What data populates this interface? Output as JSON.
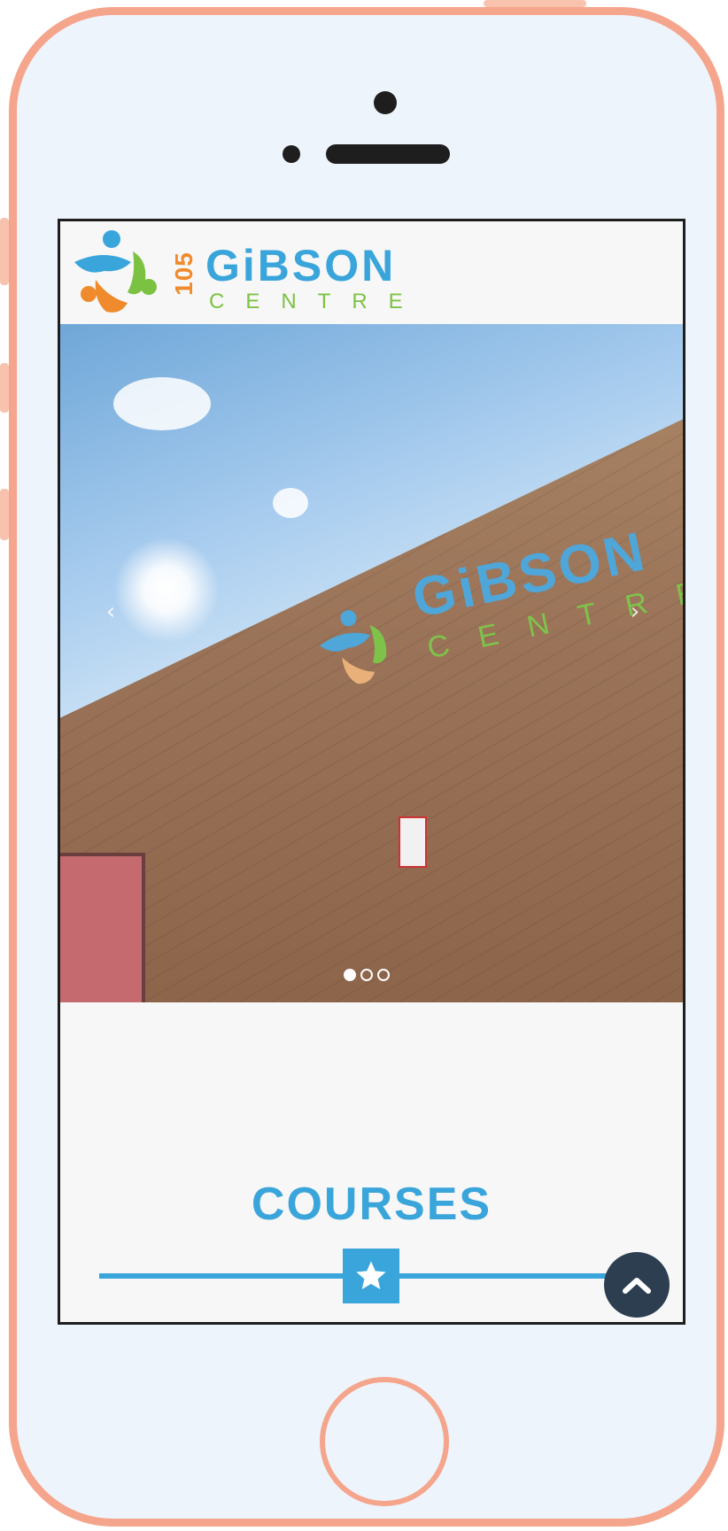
{
  "header": {
    "logo_number": "105",
    "logo_name": "GiBSON",
    "logo_sub": "CENTRE"
  },
  "slider": {
    "prev_label": "‹",
    "next_label": "›",
    "slide_count": 3,
    "active_slide": 1
  },
  "section": {
    "title": "COURSES",
    "divider_icon": "star-icon"
  },
  "scroll_top": {
    "icon": "chevron-up-icon"
  },
  "colors": {
    "brand_blue": "#3aa5db",
    "brand_green": "#7cc242",
    "brand_orange": "#ef8b2c",
    "frame": "#f4a58c",
    "scroll_button": "#2c3e50"
  }
}
